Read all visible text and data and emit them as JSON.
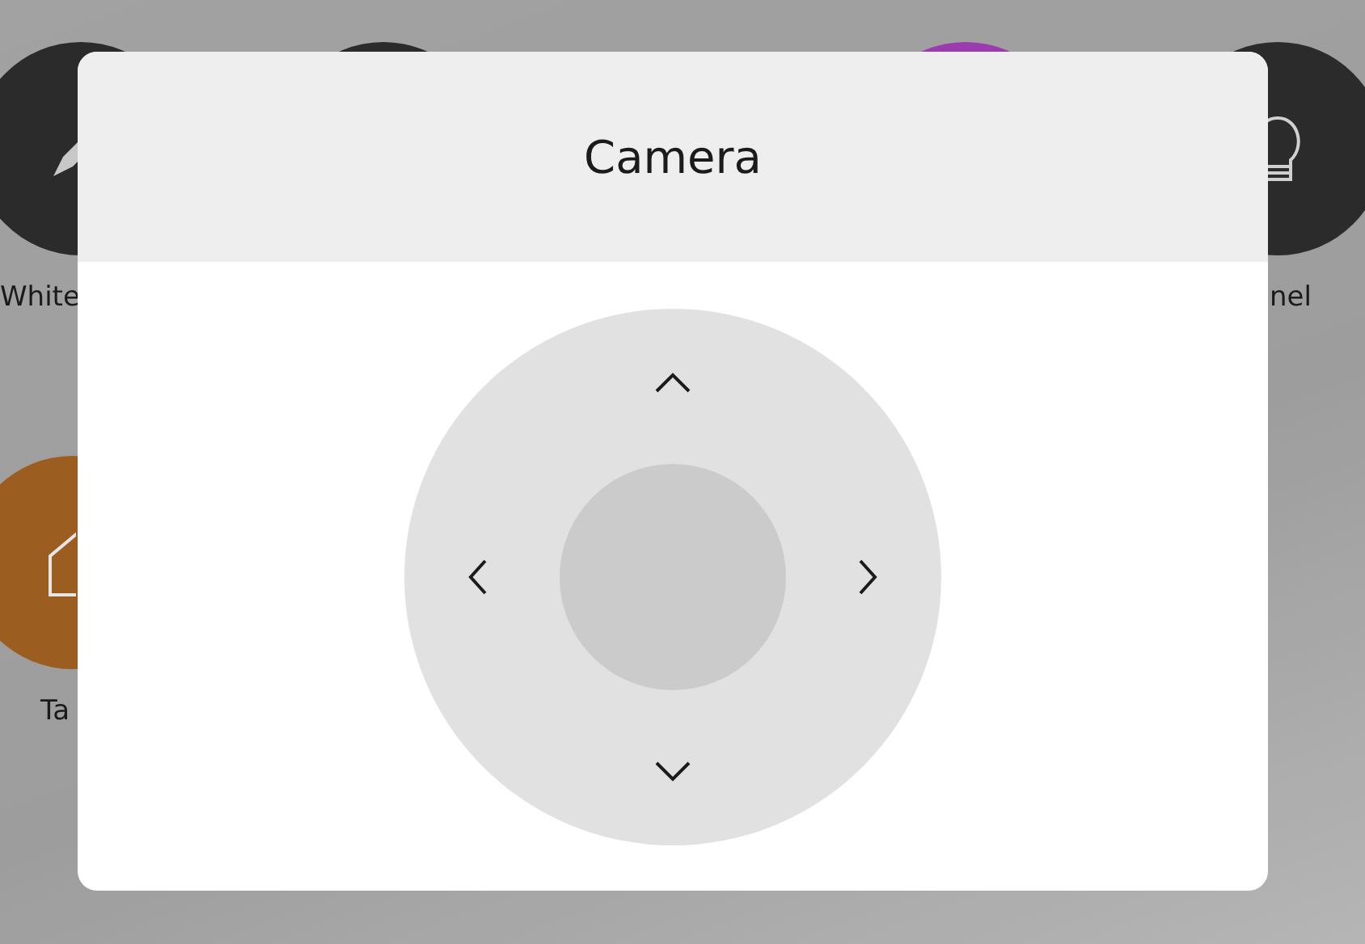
{
  "tiles": [
    {
      "kind": "pencil",
      "color": "#2b2b2b",
      "label": "White"
    },
    {
      "kind": "plain",
      "color": "#2b2b2b"
    },
    {
      "kind": "plain",
      "color": "#9a3cae"
    },
    {
      "kind": "bulb",
      "color": "#2b2b2b",
      "label": "nel"
    },
    {
      "kind": "home",
      "color": "#9c5e20",
      "label": "Ta"
    }
  ],
  "dialog": {
    "title": "Camera",
    "pad": [
      {
        "kind": "up"
      },
      {
        "kind": "left"
      },
      {
        "kind": "right"
      },
      {
        "kind": "down"
      }
    ]
  }
}
